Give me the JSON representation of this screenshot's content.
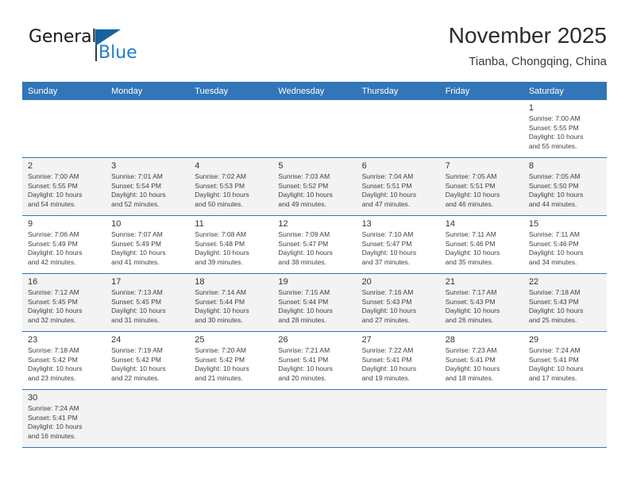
{
  "brand": {
    "name_top": "General",
    "name_bottom": "Blue",
    "accent_color": "#1f7fc4",
    "flag_color": "#15639f"
  },
  "header": {
    "title": "November 2025",
    "subtitle": "Tianba, Chongqing, China"
  },
  "theme": {
    "header_row_bg": "#3276b8",
    "header_row_text": "#ffffff",
    "shaded_row_bg": "#f3f3f3",
    "row_border": "#3276b8"
  },
  "weekdays": [
    "Sunday",
    "Monday",
    "Tuesday",
    "Wednesday",
    "Thursday",
    "Friday",
    "Saturday"
  ],
  "weeks": [
    {
      "shaded": false,
      "days": [
        {
          "num": "",
          "detail": ""
        },
        {
          "num": "",
          "detail": ""
        },
        {
          "num": "",
          "detail": ""
        },
        {
          "num": "",
          "detail": ""
        },
        {
          "num": "",
          "detail": ""
        },
        {
          "num": "",
          "detail": ""
        },
        {
          "num": "1",
          "detail": "Sunrise: 7:00 AM\nSunset: 5:55 PM\nDaylight: 10 hours\nand 55 minutes."
        }
      ]
    },
    {
      "shaded": true,
      "days": [
        {
          "num": "2",
          "detail": "Sunrise: 7:00 AM\nSunset: 5:55 PM\nDaylight: 10 hours\nand 54 minutes."
        },
        {
          "num": "3",
          "detail": "Sunrise: 7:01 AM\nSunset: 5:54 PM\nDaylight: 10 hours\nand 52 minutes."
        },
        {
          "num": "4",
          "detail": "Sunrise: 7:02 AM\nSunset: 5:53 PM\nDaylight: 10 hours\nand 50 minutes."
        },
        {
          "num": "5",
          "detail": "Sunrise: 7:03 AM\nSunset: 5:52 PM\nDaylight: 10 hours\nand 49 minutes."
        },
        {
          "num": "6",
          "detail": "Sunrise: 7:04 AM\nSunset: 5:51 PM\nDaylight: 10 hours\nand 47 minutes."
        },
        {
          "num": "7",
          "detail": "Sunrise: 7:05 AM\nSunset: 5:51 PM\nDaylight: 10 hours\nand 46 minutes."
        },
        {
          "num": "8",
          "detail": "Sunrise: 7:05 AM\nSunset: 5:50 PM\nDaylight: 10 hours\nand 44 minutes."
        }
      ]
    },
    {
      "shaded": false,
      "days": [
        {
          "num": "9",
          "detail": "Sunrise: 7:06 AM\nSunset: 5:49 PM\nDaylight: 10 hours\nand 42 minutes."
        },
        {
          "num": "10",
          "detail": "Sunrise: 7:07 AM\nSunset: 5:49 PM\nDaylight: 10 hours\nand 41 minutes."
        },
        {
          "num": "11",
          "detail": "Sunrise: 7:08 AM\nSunset: 5:48 PM\nDaylight: 10 hours\nand 39 minutes."
        },
        {
          "num": "12",
          "detail": "Sunrise: 7:09 AM\nSunset: 5:47 PM\nDaylight: 10 hours\nand 38 minutes."
        },
        {
          "num": "13",
          "detail": "Sunrise: 7:10 AM\nSunset: 5:47 PM\nDaylight: 10 hours\nand 37 minutes."
        },
        {
          "num": "14",
          "detail": "Sunrise: 7:11 AM\nSunset: 5:46 PM\nDaylight: 10 hours\nand 35 minutes."
        },
        {
          "num": "15",
          "detail": "Sunrise: 7:11 AM\nSunset: 5:46 PM\nDaylight: 10 hours\nand 34 minutes."
        }
      ]
    },
    {
      "shaded": true,
      "days": [
        {
          "num": "16",
          "detail": "Sunrise: 7:12 AM\nSunset: 5:45 PM\nDaylight: 10 hours\nand 32 minutes."
        },
        {
          "num": "17",
          "detail": "Sunrise: 7:13 AM\nSunset: 5:45 PM\nDaylight: 10 hours\nand 31 minutes."
        },
        {
          "num": "18",
          "detail": "Sunrise: 7:14 AM\nSunset: 5:44 PM\nDaylight: 10 hours\nand 30 minutes."
        },
        {
          "num": "19",
          "detail": "Sunrise: 7:15 AM\nSunset: 5:44 PM\nDaylight: 10 hours\nand 28 minutes."
        },
        {
          "num": "20",
          "detail": "Sunrise: 7:16 AM\nSunset: 5:43 PM\nDaylight: 10 hours\nand 27 minutes."
        },
        {
          "num": "21",
          "detail": "Sunrise: 7:17 AM\nSunset: 5:43 PM\nDaylight: 10 hours\nand 26 minutes."
        },
        {
          "num": "22",
          "detail": "Sunrise: 7:18 AM\nSunset: 5:43 PM\nDaylight: 10 hours\nand 25 minutes."
        }
      ]
    },
    {
      "shaded": false,
      "days": [
        {
          "num": "23",
          "detail": "Sunrise: 7:18 AM\nSunset: 5:42 PM\nDaylight: 10 hours\nand 23 minutes."
        },
        {
          "num": "24",
          "detail": "Sunrise: 7:19 AM\nSunset: 5:42 PM\nDaylight: 10 hours\nand 22 minutes."
        },
        {
          "num": "25",
          "detail": "Sunrise: 7:20 AM\nSunset: 5:42 PM\nDaylight: 10 hours\nand 21 minutes."
        },
        {
          "num": "26",
          "detail": "Sunrise: 7:21 AM\nSunset: 5:41 PM\nDaylight: 10 hours\nand 20 minutes."
        },
        {
          "num": "27",
          "detail": "Sunrise: 7:22 AM\nSunset: 5:41 PM\nDaylight: 10 hours\nand 19 minutes."
        },
        {
          "num": "28",
          "detail": "Sunrise: 7:23 AM\nSunset: 5:41 PM\nDaylight: 10 hours\nand 18 minutes."
        },
        {
          "num": "29",
          "detail": "Sunrise: 7:24 AM\nSunset: 5:41 PM\nDaylight: 10 hours\nand 17 minutes."
        }
      ]
    },
    {
      "shaded": true,
      "days": [
        {
          "num": "30",
          "detail": "Sunrise: 7:24 AM\nSunset: 5:41 PM\nDaylight: 10 hours\nand 16 minutes."
        },
        {
          "num": "",
          "detail": ""
        },
        {
          "num": "",
          "detail": ""
        },
        {
          "num": "",
          "detail": ""
        },
        {
          "num": "",
          "detail": ""
        },
        {
          "num": "",
          "detail": ""
        },
        {
          "num": "",
          "detail": ""
        }
      ]
    }
  ]
}
